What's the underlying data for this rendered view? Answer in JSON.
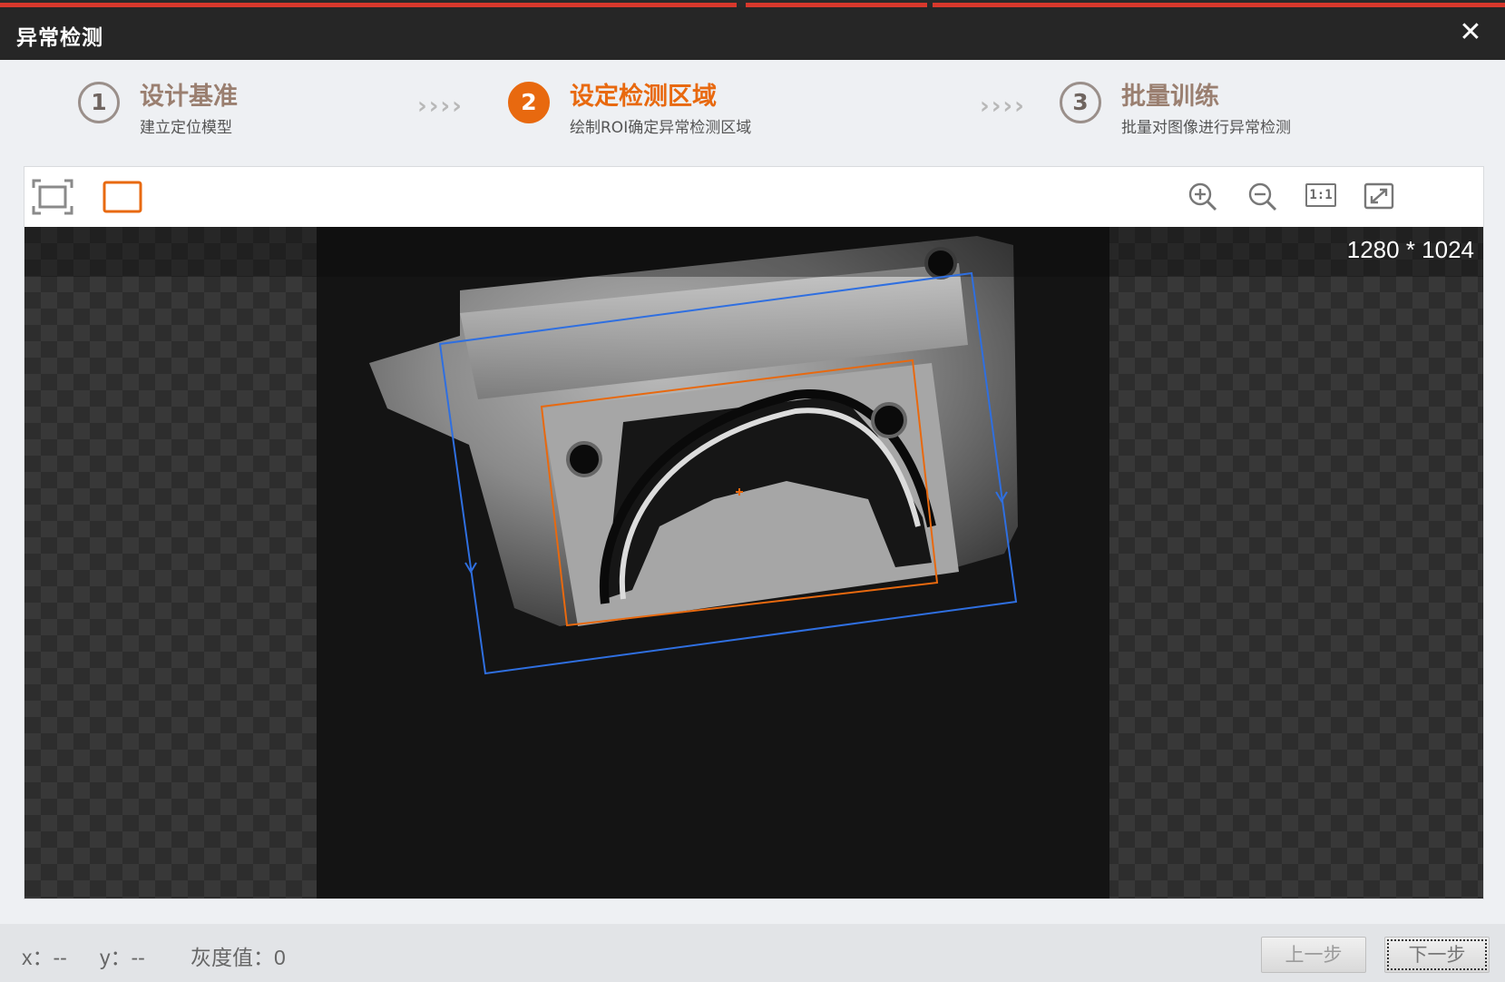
{
  "window": {
    "title": "异常检测",
    "close_glyph": "✕"
  },
  "steps": [
    {
      "number": "1",
      "title": "设计基准",
      "subtitle": "建立定位模型",
      "active": false
    },
    {
      "number": "2",
      "title": "设定检测区域",
      "subtitle": "绘制ROI确定异常检测区域",
      "active": true
    },
    {
      "number": "3",
      "title": "批量训练",
      "subtitle": "批量对图像进行异常检测",
      "active": false
    }
  ],
  "step_separator": "››››",
  "toolbar": {
    "left_tools": [
      "fit-view-icon",
      "rectangle-roi-icon"
    ],
    "right_tools": [
      "zoom-in-icon",
      "zoom-out-icon",
      "actual-size-icon",
      "fullscreen-icon"
    ],
    "actual_size_label": "1:1"
  },
  "canvas": {
    "resolution": "1280 * 1024",
    "model_roi_color": "#2f6fe0",
    "detect_roi_color": "#e8690f"
  },
  "status": {
    "x_label": "x：",
    "x_value": "--",
    "y_label": "y：",
    "y_value": "--",
    "gray_label": "灰度值：",
    "gray_value": "0"
  },
  "buttons": {
    "prev": "上一步",
    "next": "下一步"
  },
  "colors": {
    "accent": "#e8690f",
    "titlebar": "#262626",
    "progress": "#d8382c"
  }
}
